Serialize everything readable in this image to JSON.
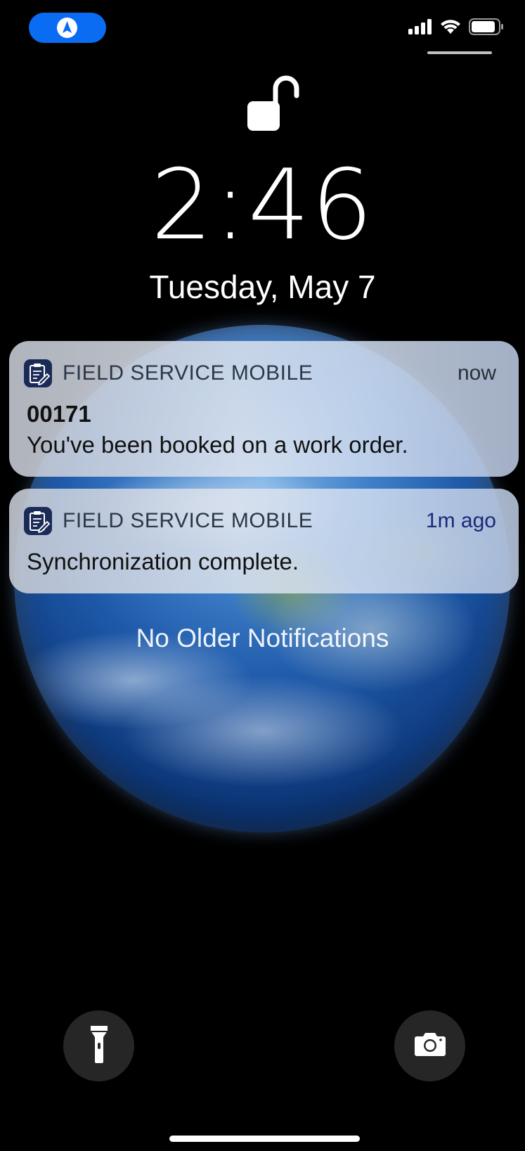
{
  "status_bar": {
    "nav_icon": "location-arrow-icon",
    "signal_icon": "cellular-signal-icon",
    "wifi_icon": "wifi-icon",
    "battery_icon": "battery-icon",
    "nav_pill_color": "#0a6cf2"
  },
  "lock": {
    "icon": "unlocked-padlock-icon",
    "time": "2:46",
    "date": "Tuesday, May 7"
  },
  "notifications": [
    {
      "app_name": "FIELD SERVICE MOBILE",
      "app_icon": "clipboard-pencil-icon",
      "time": "now",
      "title": "00171",
      "body": "You've been booked on a work order."
    },
    {
      "app_name": "FIELD SERVICE MOBILE",
      "app_icon": "clipboard-pencil-icon",
      "time": "1m ago",
      "body": "Synchronization complete."
    }
  ],
  "no_older_text": "No Older Notifications",
  "quick_actions": {
    "flashlight_icon": "flashlight-icon",
    "camera_icon": "camera-icon"
  }
}
